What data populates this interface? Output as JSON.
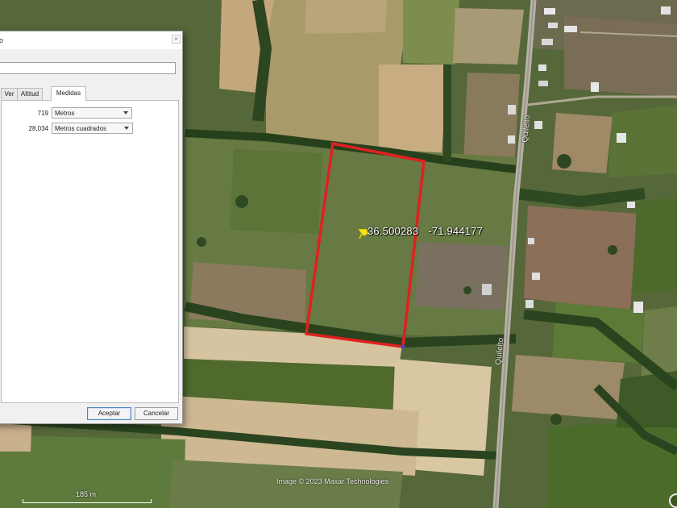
{
  "dialog": {
    "title": "o",
    "close_glyph": "×",
    "name_value": "",
    "tabs": [
      "Ver",
      "Altitud",
      "Medidas"
    ],
    "active_tab": "Medidas",
    "measures": [
      {
        "value": "719",
        "unit": "Metros"
      },
      {
        "value": "28,034",
        "unit": "Metros cuadrados"
      }
    ],
    "accept_label": "Aceptar",
    "cancel_label": "Cancelar"
  },
  "map": {
    "coord_lat": "36.500283",
    "coord_lon": "-71.944177",
    "road_label_1": "Quilelto",
    "road_label_2": "Quilelto",
    "attribution": "Image © 2023 Maxar Technologies",
    "scale_label": "185 m",
    "polygon_color": "#e02020",
    "pin_icon": "yellow-pushpin-icon"
  }
}
